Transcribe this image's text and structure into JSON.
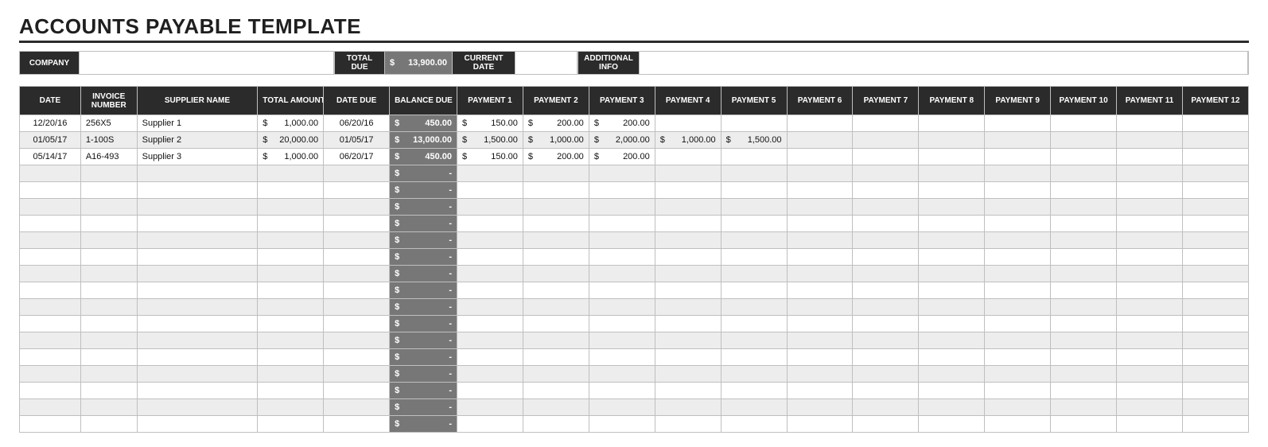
{
  "title": "ACCOUNTS PAYABLE TEMPLATE",
  "summary": {
    "company_label": "COMPANY",
    "company_value": "",
    "total_due_label": "TOTAL DUE",
    "total_due_value": "13,900.00",
    "current_date_label": "CURRENT DATE",
    "current_date_value": "",
    "additional_info_label": "ADDITIONAL INFO",
    "additional_info_value": ""
  },
  "columns": [
    "DATE",
    "INVOICE NUMBER",
    "SUPPLIER NAME",
    "TOTAL AMOUNT",
    "DATE DUE",
    "BALANCE DUE",
    "PAYMENT 1",
    "PAYMENT 2",
    "PAYMENT 3",
    "PAYMENT 4",
    "PAYMENT 5",
    "PAYMENT 6",
    "PAYMENT 7",
    "PAYMENT 8",
    "PAYMENT 9",
    "PAYMENT 10",
    "PAYMENT 11",
    "PAYMENT 12"
  ],
  "currency_symbol": "$",
  "empty_balance_symbol": "-",
  "rows": [
    {
      "date": "12/20/16",
      "invoice": "256X5",
      "supplier": "Supplier 1",
      "total": "1,000.00",
      "due": "06/20/16",
      "balance": "450.00",
      "payments": [
        "150.00",
        "200.00",
        "200.00",
        "",
        "",
        "",
        "",
        "",
        "",
        "",
        "",
        ""
      ]
    },
    {
      "date": "01/05/17",
      "invoice": "1-100S",
      "supplier": "Supplier 2",
      "total": "20,000.00",
      "due": "01/05/17",
      "balance": "13,000.00",
      "payments": [
        "1,500.00",
        "1,000.00",
        "2,000.00",
        "1,000.00",
        "1,500.00",
        "",
        "",
        "",
        "",
        "",
        "",
        ""
      ]
    },
    {
      "date": "05/14/17",
      "invoice": "A16-493",
      "supplier": "Supplier 3",
      "total": "1,000.00",
      "due": "06/20/17",
      "balance": "450.00",
      "payments": [
        "150.00",
        "200.00",
        "200.00",
        "",
        "",
        "",
        "",
        "",
        "",
        "",
        "",
        ""
      ]
    }
  ],
  "empty_row_count": 16
}
